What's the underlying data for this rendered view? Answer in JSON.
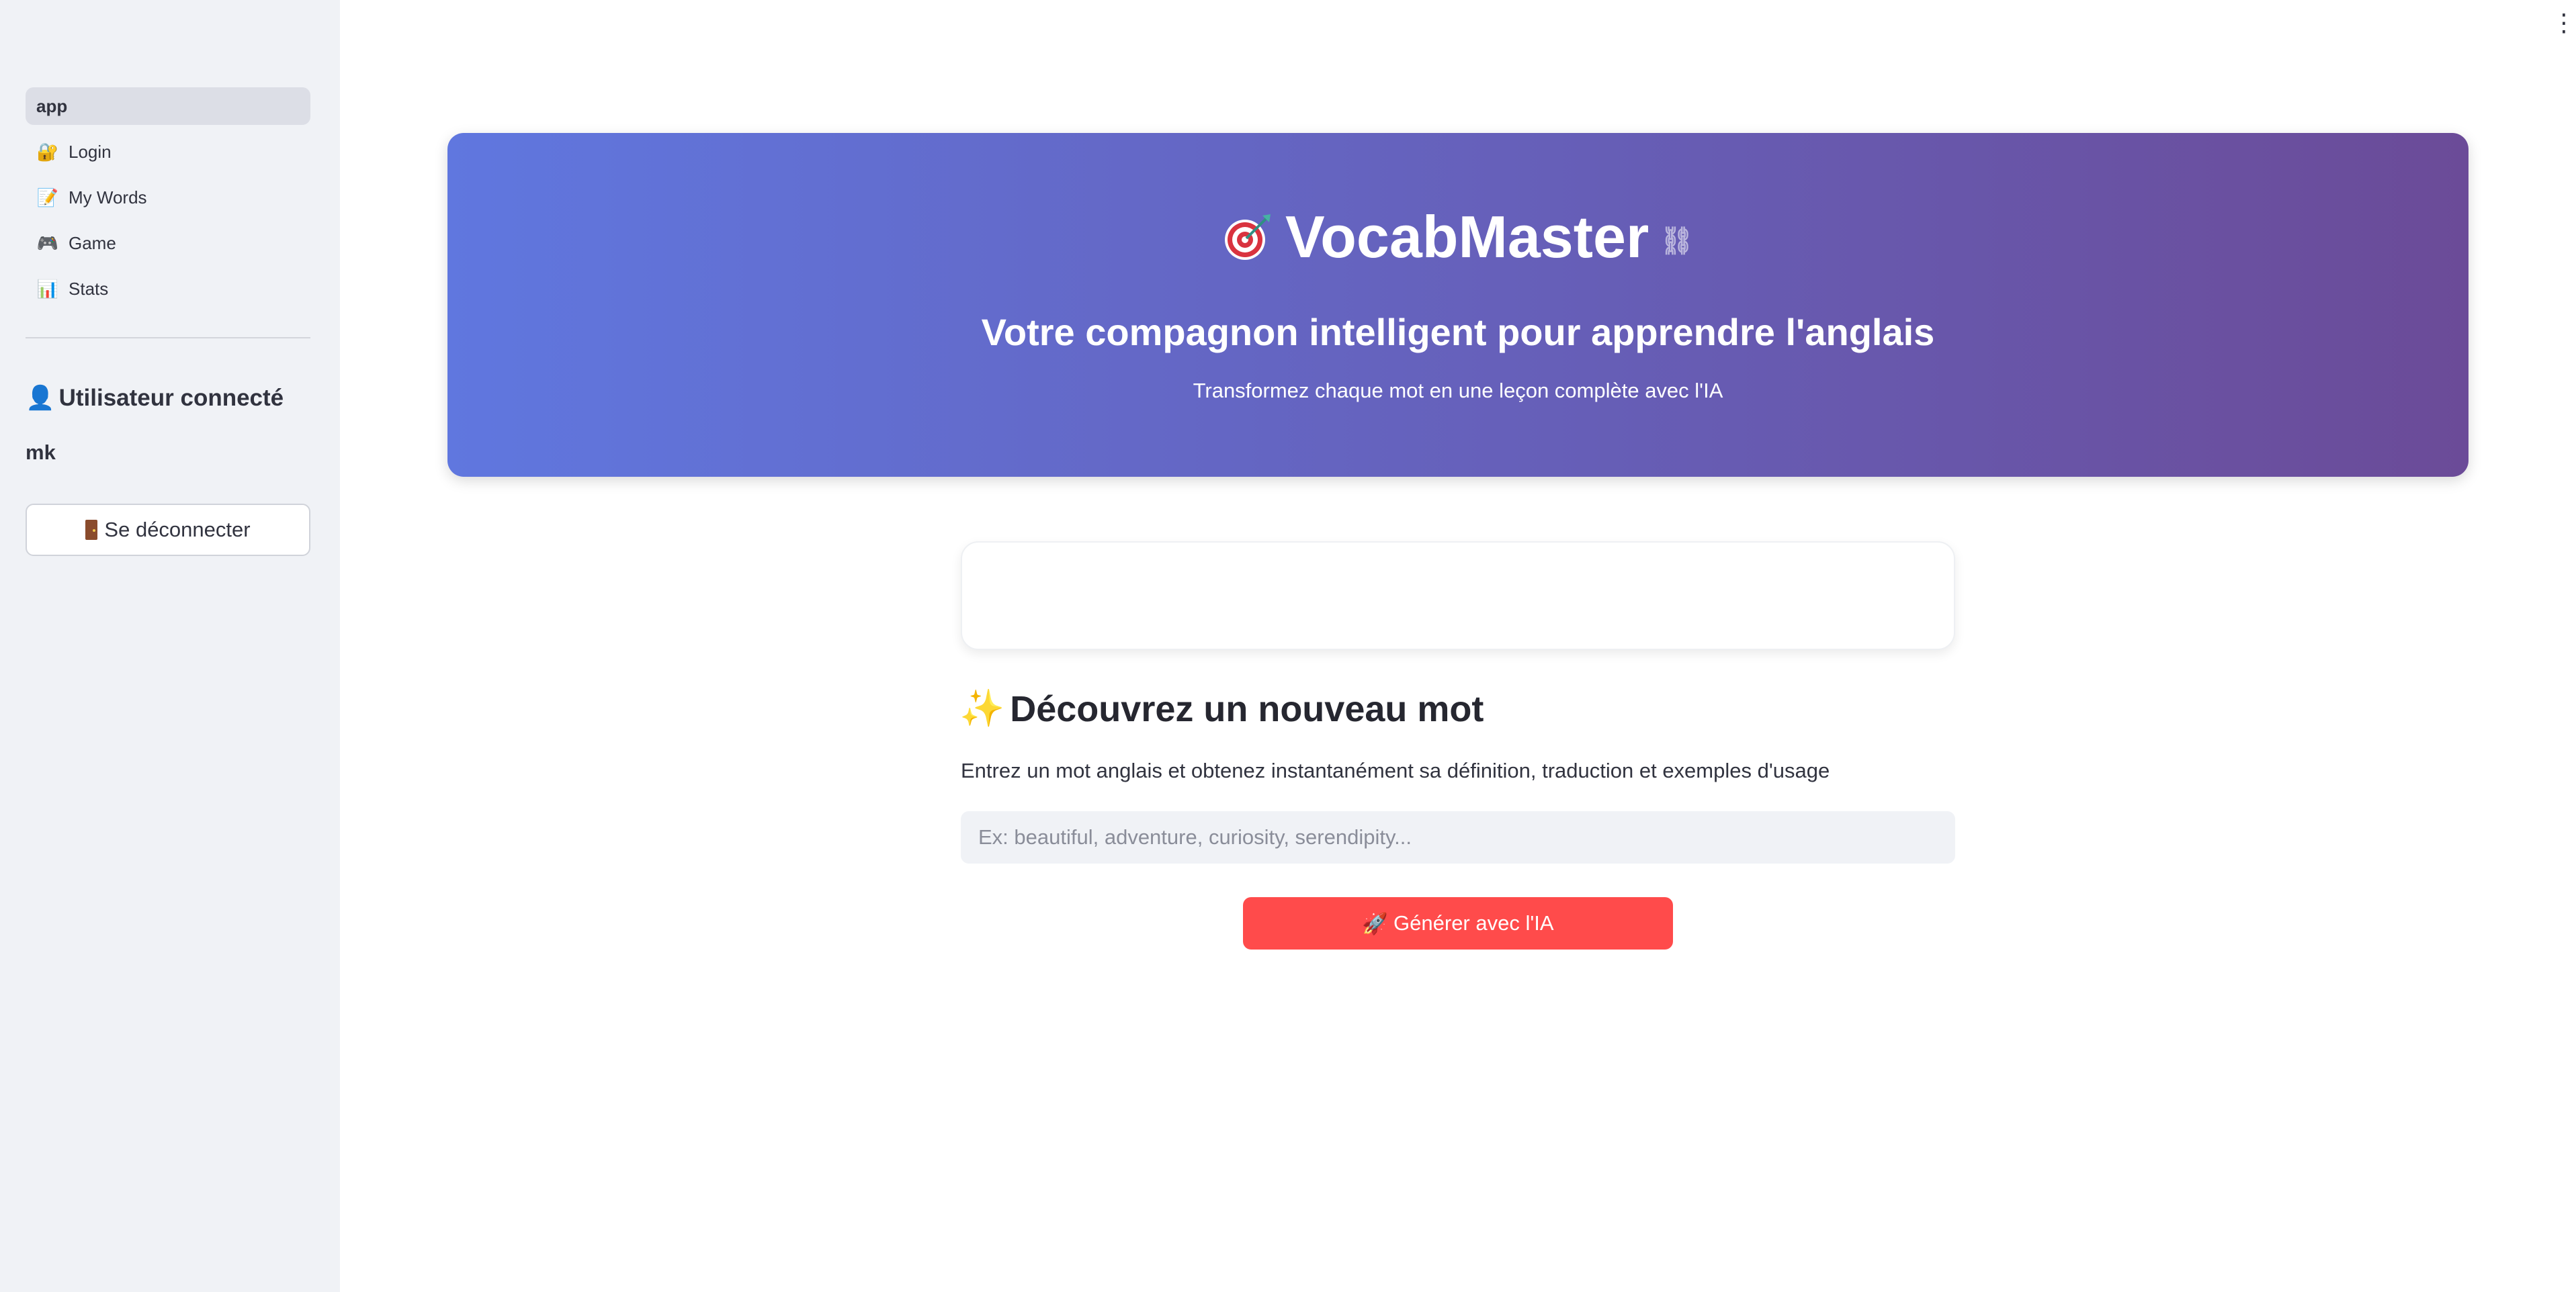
{
  "sidebar": {
    "nav_items": [
      {
        "label": "app",
        "icon": "",
        "active": true
      },
      {
        "label": "Login",
        "icon": "🔐"
      },
      {
        "label": "My Words",
        "icon": "📝"
      },
      {
        "label": "Game",
        "icon": "🎮"
      },
      {
        "label": "Stats",
        "icon": "📊"
      }
    ],
    "user_heading": "Utilisateur connecté",
    "user_icon": "👤",
    "username": "mk",
    "logout_label": "Se déconnecter",
    "logout_icon": "door-icon"
  },
  "hero": {
    "title": "VocabMaster",
    "title_icon": "target-icon",
    "subtitle": "Votre compagnon intelligent pour apprendre l'anglais",
    "tagline": "Transformez chaque mot en une leçon complète avec l'IA",
    "gradient_start": "#6077df",
    "gradient_end": "#6b4b98"
  },
  "main": {
    "section_title": "Découvrez un nouveau mot",
    "section_icon": "✨",
    "section_desc": "Entrez un mot anglais et obtenez instantanément sa définition, traduction et exemples d'usage",
    "input_placeholder": "Ex: beautiful, adventure, curiosity, serendipity...",
    "input_value": "",
    "generate_label": "Générer avec l'IA",
    "generate_icon": "🚀",
    "accent_color": "#ff4b4b"
  },
  "menu_icon": "⋮"
}
